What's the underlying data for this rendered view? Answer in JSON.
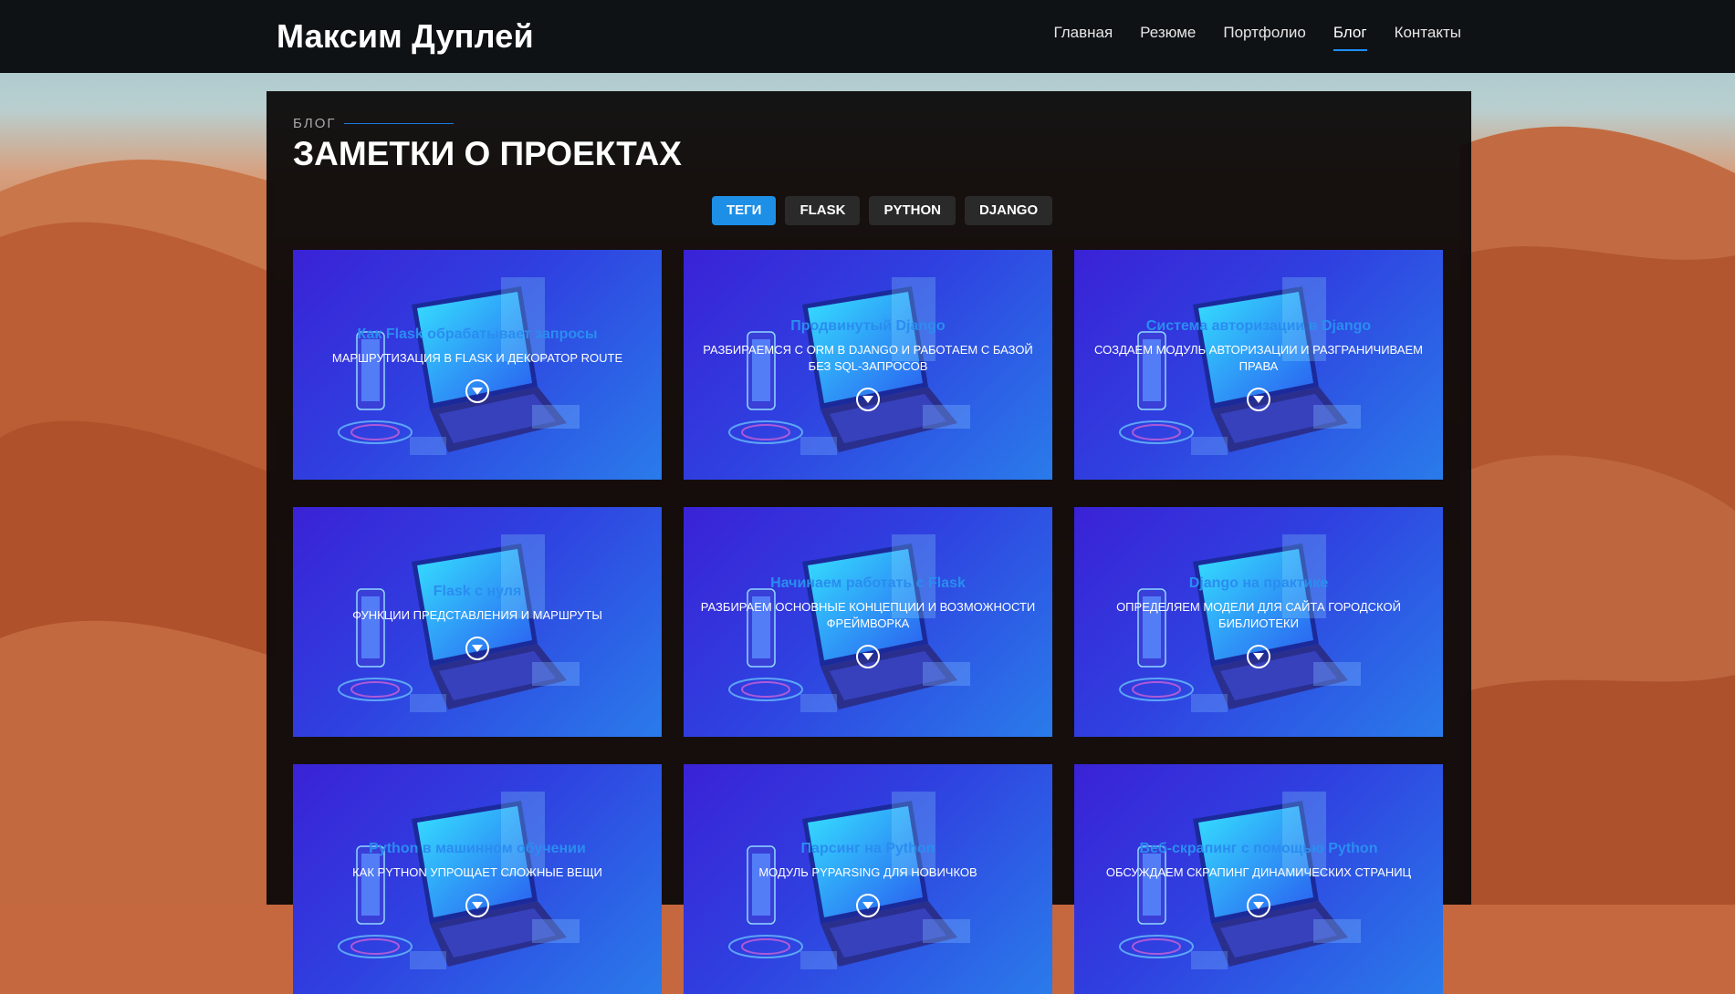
{
  "header": {
    "brand": "Максим Дуплей",
    "nav": [
      {
        "label": "Главная",
        "active": false
      },
      {
        "label": "Резюме",
        "active": false
      },
      {
        "label": "Портфолио",
        "active": false
      },
      {
        "label": "Блог",
        "active": true
      },
      {
        "label": "Контакты",
        "active": false
      }
    ]
  },
  "section": {
    "kicker": "БЛОГ",
    "title": "ЗАМЕТКИ О ПРОЕКТАХ",
    "filters": [
      {
        "label": "ТЕГИ",
        "active": true
      },
      {
        "label": "FLASK",
        "active": false
      },
      {
        "label": "PYTHON",
        "active": false
      },
      {
        "label": "DJANGO",
        "active": false
      }
    ]
  },
  "posts": [
    {
      "title": "Как Flask обрабатывает запросы",
      "subtitle": "Маршрутизация в Flask и декоратор route"
    },
    {
      "title": "Продвинутый Django",
      "subtitle": "Разбираемся с ORM в Django и работаем с базой без SQL-запросов"
    },
    {
      "title": "Система авторизации в Django",
      "subtitle": "Создаем модуль авторизации и разграничиваем права"
    },
    {
      "title": "Flask с нуля",
      "subtitle": "Функции представления и маршруты"
    },
    {
      "title": "Начинаем работать с Flask",
      "subtitle": "Разбираем основные концепции и возможности фреймворка"
    },
    {
      "title": "Django на практике",
      "subtitle": "Определяем модели для сайта городской библиотеки"
    },
    {
      "title": "Python в машинном обучении",
      "subtitle": "Как Python упрощает сложные вещи"
    },
    {
      "title": "Парсинг на Python",
      "subtitle": "Модуль pyparsing для новичков"
    },
    {
      "title": "Веб-скрапинг с помощью Python",
      "subtitle": "Обсуждаем скрапинг динамических страниц"
    }
  ],
  "colors": {
    "accent": "#1d8fe6",
    "card_title": "#2a8df0",
    "header_bg": "#080a0c"
  },
  "icons": {
    "card_action": "chevron-down-circle-icon"
  }
}
